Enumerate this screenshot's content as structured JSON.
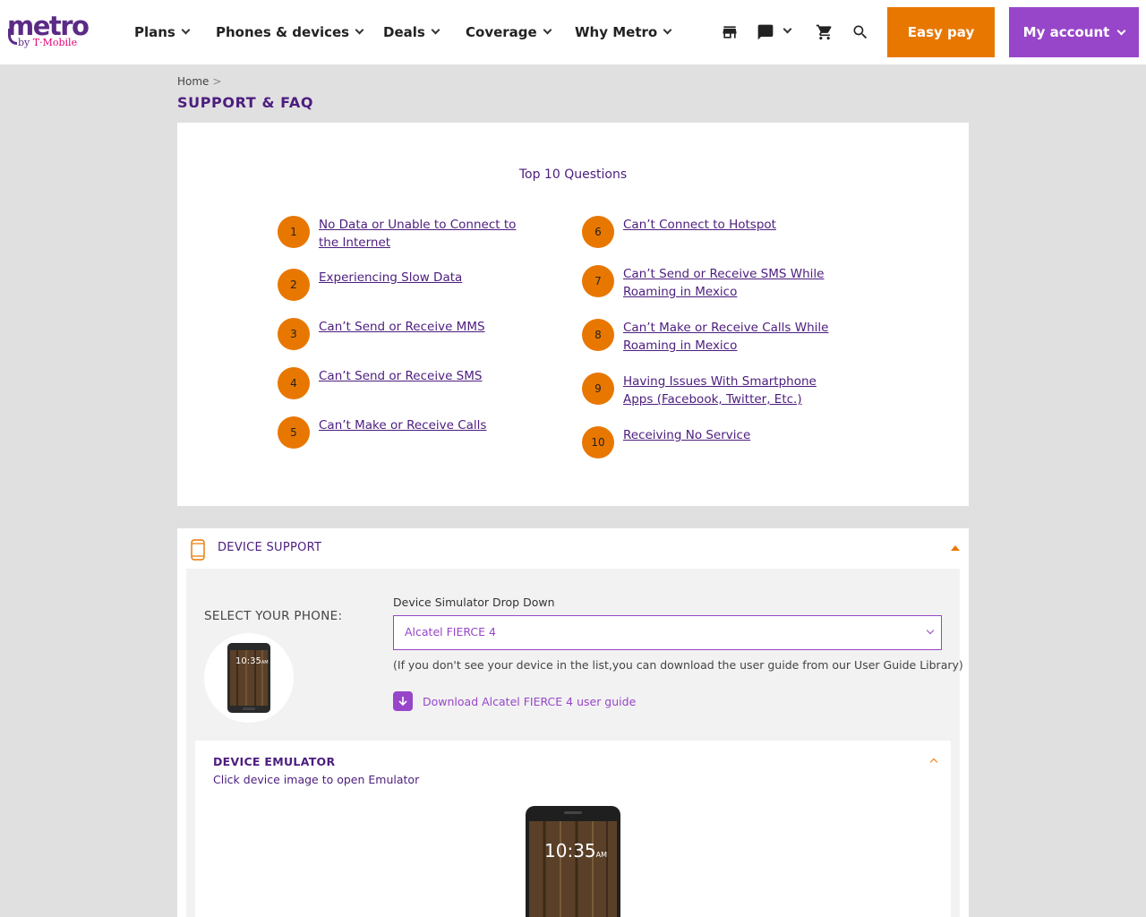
{
  "header": {
    "logo": {
      "word": "metro",
      "by": "by",
      "brand": "T·Mobile"
    },
    "nav": [
      {
        "label": "Plans"
      },
      {
        "label": "Phones & devices"
      },
      {
        "label": "Deals"
      },
      {
        "label": "Coverage"
      },
      {
        "label": "Why Metro"
      }
    ],
    "icons": [
      "store-icon",
      "chat-icon",
      "cart-icon",
      "search-icon"
    ],
    "easy_pay": "Easy pay",
    "my_account": "My account"
  },
  "breadcrumb": {
    "home": "Home",
    "separator": ">"
  },
  "page_title": "SUPPORT & FAQ",
  "top_questions": {
    "title": "Top 10 Questions",
    "items": [
      {
        "num": "1",
        "text": "No Data or Unable to Connect to the Internet"
      },
      {
        "num": "2",
        "text": "Experiencing Slow Data"
      },
      {
        "num": "3",
        "text": "Can’t Send or Receive MMS"
      },
      {
        "num": "4",
        "text": "Can’t Send or Receive SMS"
      },
      {
        "num": "5",
        "text": "Can’t Make or Receive Calls"
      },
      {
        "num": "6",
        "text": "Can’t Connect to Hotspot"
      },
      {
        "num": "7",
        "text": "Can’t Send or Receive SMS While Roaming in Mexico"
      },
      {
        "num": "8",
        "text": "Can’t Make or Receive Calls While Roaming in Mexico"
      },
      {
        "num": "9",
        "text": "Having Issues With Smartphone Apps (Facebook, Twitter, Etc.)"
      },
      {
        "num": "10",
        "text": "Receiving No Service"
      }
    ]
  },
  "device_support": {
    "title": "DEVICE SUPPORT",
    "select_label": "SELECT YOUR PHONE:",
    "dropdown_label": "Device Simulator Drop Down",
    "dropdown_value": "Alcatel FIERCE 4",
    "note": "(If you don't see your device in the list,you can download the user guide from our User Guide Library)",
    "download_text": "Download Alcatel FIERCE 4 user guide",
    "phone_time": "10:35",
    "phone_ampm": "AM"
  },
  "emulator": {
    "title": "DEVICE EMULATOR",
    "subtitle": "Click device image to open Emulator",
    "phone_time": "10:35",
    "phone_ampm": "AM"
  },
  "colors": {
    "purple_dark": "#4c1d7e",
    "purple": "#9746c9",
    "orange": "#e87700",
    "magenta": "#e20074"
  }
}
